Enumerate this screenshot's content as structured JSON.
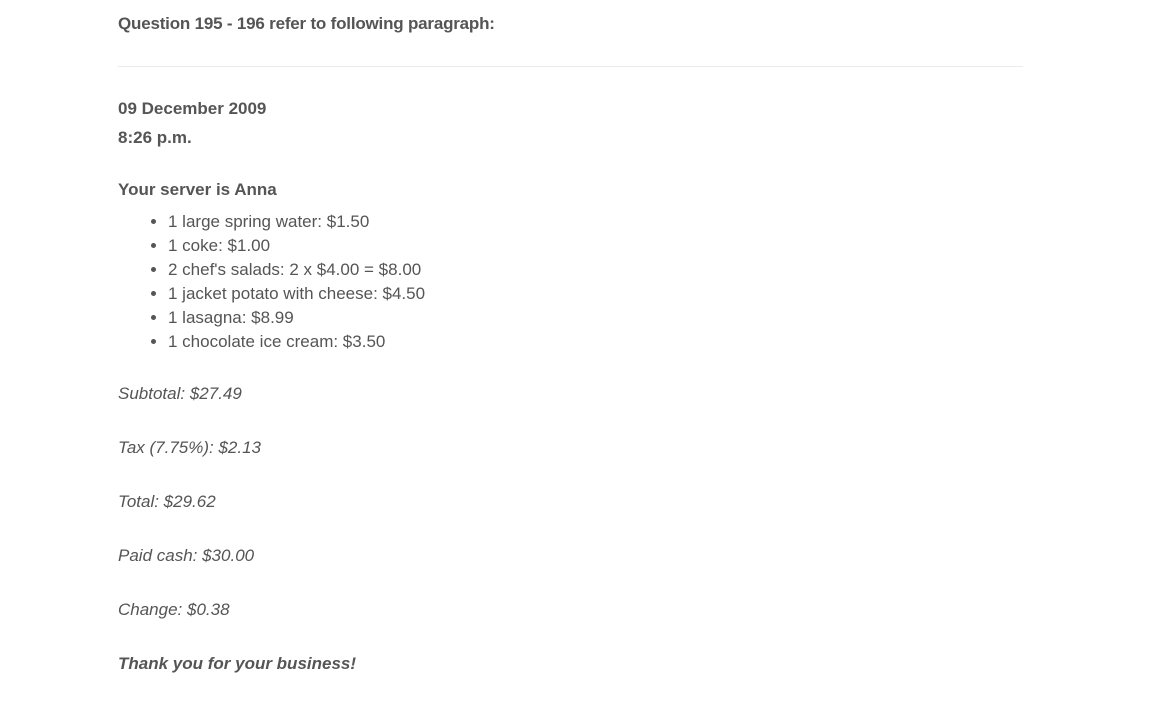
{
  "question": {
    "heading": "Question 195 - 196 refer to following paragraph:"
  },
  "receipt": {
    "date": "09 December 2009",
    "time": "8:26 p.m.",
    "server": "Your server is Anna",
    "items": [
      "1 large spring water: $1.50",
      "1 coke: $1.00",
      "2 chef's salads: 2 x $4.00 = $8.00",
      "1 jacket potato with cheese: $4.50",
      "1 lasagna: $8.99",
      "1 chocolate ice cream: $3.50"
    ],
    "subtotal": "Subtotal: $27.49",
    "tax": "Tax (7.75%): $2.13",
    "total": "Total: $29.62",
    "paid": "Paid cash: $30.00",
    "change": "Change: $0.38",
    "thanks": "Thank you for your business!"
  }
}
